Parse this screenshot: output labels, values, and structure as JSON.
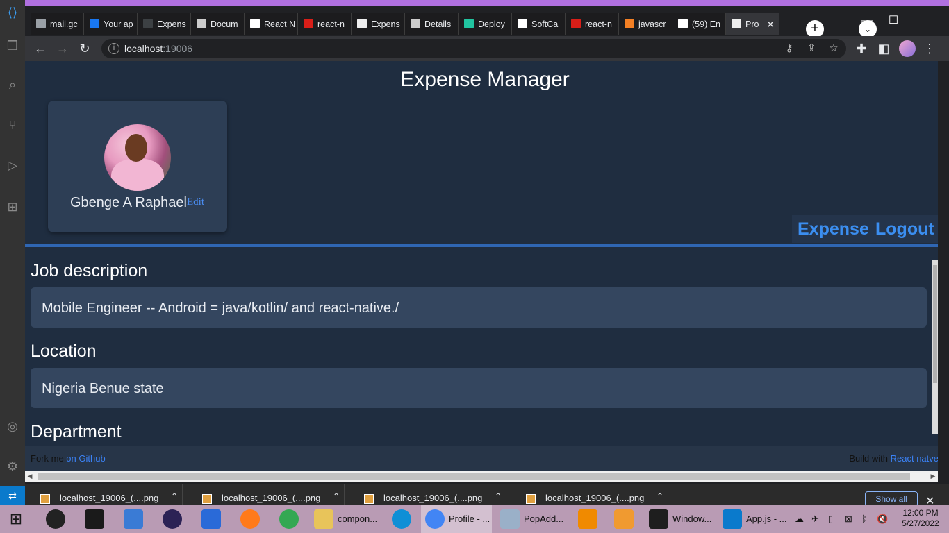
{
  "browser": {
    "tabs": [
      {
        "label": "mail.gc",
        "color": "#9aa0a6"
      },
      {
        "label": "Your ap",
        "color": "#1877f2"
      },
      {
        "label": "Expens",
        "color": "#3c4043"
      },
      {
        "label": "Docum",
        "color": "#cccccc"
      },
      {
        "label": "React N",
        "color": "#ffffff"
      },
      {
        "label": "react-n",
        "color": "#d91e18"
      },
      {
        "label": "Expens",
        "color": "#eeeeee"
      },
      {
        "label": "Details",
        "color": "#cccccc"
      },
      {
        "label": "Deploy",
        "color": "#21c4a0"
      },
      {
        "label": "SoftCa",
        "color": "#ffffff"
      },
      {
        "label": "react-n",
        "color": "#d91e18"
      },
      {
        "label": "javascr",
        "color": "#f48024"
      },
      {
        "label": "(59) En",
        "color": "#ffffff"
      },
      {
        "label": "Pro",
        "color": "#eeeeee",
        "active": true
      }
    ],
    "url_host": "localhost",
    "url_port": ":19006"
  },
  "app": {
    "title": "Expense Manager",
    "profile": {
      "name": "Gbenge A Raphael",
      "edit_label": "Edit"
    },
    "nav": {
      "expense": "Expense",
      "logout": "Logout"
    },
    "sections": [
      {
        "heading": "Job description",
        "value": "Mobile Engineer -- Android = java/kotlin/ and react-native./"
      },
      {
        "heading": "Location",
        "value": "Nigeria Benue state"
      },
      {
        "heading": "Department",
        "value": ""
      }
    ],
    "footer": {
      "left_prefix": "Fork me",
      "left_link": "on Github",
      "right_prefix": "Build with",
      "right_link": "React natve"
    }
  },
  "downloads": {
    "items": [
      "localhost_19006_(....png",
      "localhost_19006_(....png",
      "localhost_19006_(....png",
      "localhost_19006_(....png"
    ],
    "show_all": "Show all"
  },
  "taskbar": {
    "apps": [
      {
        "label": "compon...",
        "color": "#e8c45a"
      },
      {
        "label": "Profile - ...",
        "color": "#4285f4",
        "active": true
      },
      {
        "label": "PopAdd...",
        "color": "#9ab0c8"
      },
      {
        "label": "Window...",
        "color": "#1e1e1e"
      },
      {
        "label": "App.js - ...",
        "color": "#0a7acc"
      }
    ],
    "time": "12:00 PM",
    "date": "5/27/2022"
  }
}
